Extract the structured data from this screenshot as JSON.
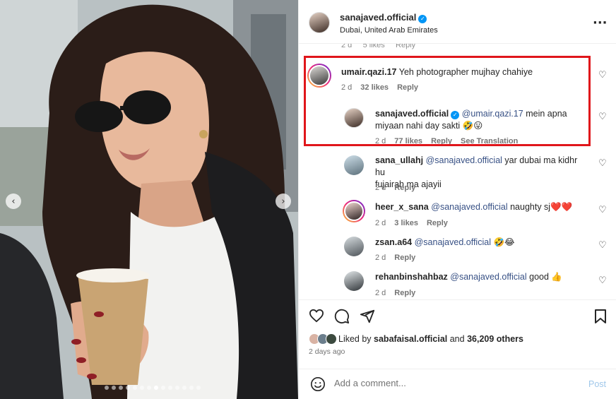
{
  "post": {
    "username": "sanajaved.official",
    "location": "Dubai, United Arab Emirates",
    "cut_off_meta": "2 d     5 likes     Reply",
    "carousel_dots": 14,
    "carousel_active": 7
  },
  "comments": [
    {
      "user": "umair.qazi.17",
      "text": "Yeh photographer mujhay chahiye",
      "time": "2 d",
      "likes": "32 likes",
      "reply": "Reply"
    },
    {
      "user": "sanajaved.official",
      "mention": "@umair.qazi.17",
      "text_line1": " mein apna",
      "text_line2": "miyaan nahi day sakti 🤣😛",
      "time": "2 d",
      "likes": "77 likes",
      "reply": "Reply",
      "translation": "See Translation"
    },
    {
      "user": "sana_ullahj",
      "mention": "@sanajaved.official",
      "text_line1": " yar dubai ma kidhr hu",
      "text_line2": "fujairah ma ajayii",
      "time": "2 d",
      "reply": "Reply"
    },
    {
      "user": "heer_x_sana",
      "mention": "@sanajaved.official",
      "text": " naughty sj❤️❤️",
      "time": "2 d",
      "likes": "3 likes",
      "reply": "Reply"
    },
    {
      "user": "zsan.a64",
      "mention": "@sanajaved.official",
      "text": " 🤣😂",
      "time": "2 d",
      "reply": "Reply"
    },
    {
      "user": "rehanbinshahbaz",
      "mention": "@sanajaved.official",
      "text": " good 👍",
      "time": "2 d",
      "reply": "Reply"
    }
  ],
  "likes_line": {
    "prefix": "Liked by ",
    "user": "sabafaisal.official",
    "and": " and ",
    "count": "36,209 others"
  },
  "posted_ago": "2 days ago",
  "comment_box": {
    "placeholder": "Add a comment...",
    "post_label": "Post"
  },
  "colors": {
    "accent": "#0095f6",
    "mention": "#385185",
    "highlight": "#e0161b"
  },
  "icons": [
    "more-icon",
    "heart-icon",
    "comment-icon",
    "share-icon",
    "bookmark-icon",
    "emoji-icon",
    "verified-icon"
  ]
}
